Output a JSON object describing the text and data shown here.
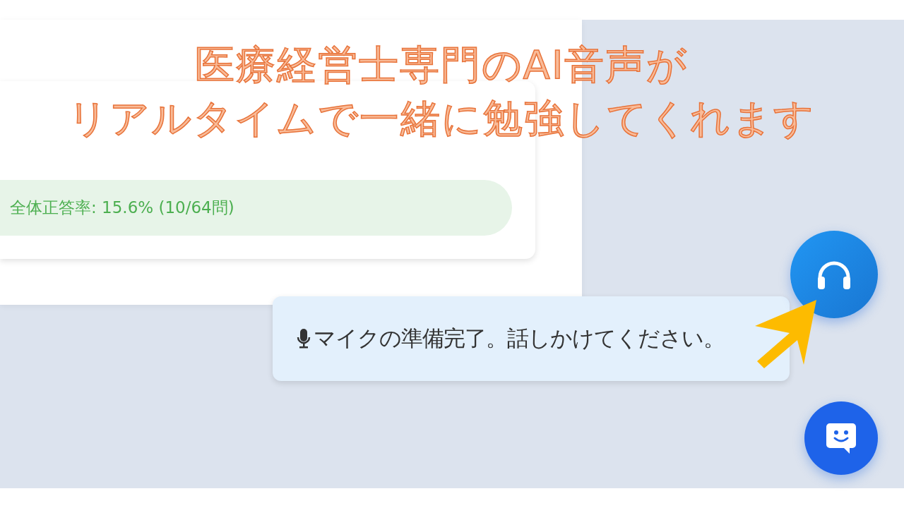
{
  "caption": {
    "lines": [
      "医療経営士専門のAI音声が",
      "リアルタイムで一緒に勉強してくれます"
    ]
  },
  "results_card": {
    "accuracy": "全体正答率: 15.6% (10/64問)"
  },
  "voice_toast": {
    "message": "マイクの準備完了。話しかけてください。"
  },
  "floating_buttons": [
    {
      "kind": "voice"
    },
    {
      "kind": "chat"
    }
  ]
}
